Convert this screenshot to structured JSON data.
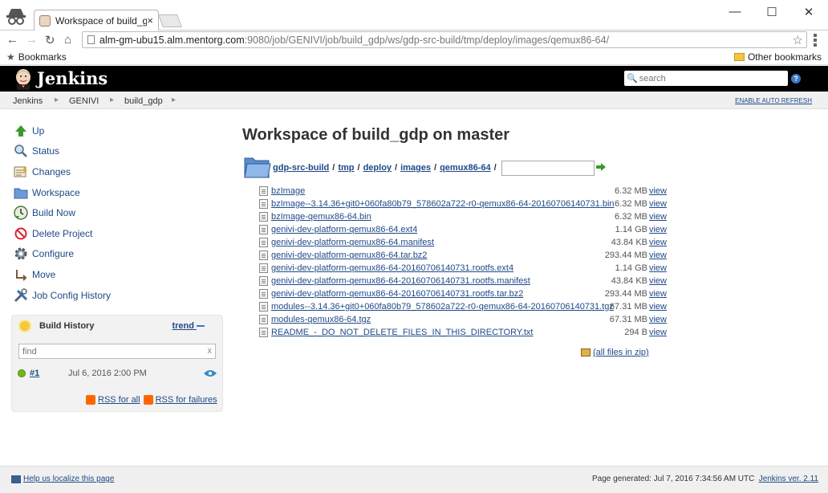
{
  "browser": {
    "tab_title": "Workspace of build_g",
    "tab_close": "×",
    "window_controls": {
      "minimize": "—",
      "maximize": "☐",
      "close": "✕"
    },
    "url_host": "alm-gm-ubu15.alm.mentorg.com",
    "url_path": ":9080/job/GENIVI/job/build_gdp/ws/gdp-src-build/tmp/deploy/images/qemux86-64/",
    "bookmarks_label": "Bookmarks",
    "other_bookmarks_label": "Other bookmarks"
  },
  "header": {
    "logo_text": "Jenkins",
    "search_placeholder": "search",
    "help_label": "?"
  },
  "breadcrumbs": {
    "items": [
      "Jenkins",
      "GENIVI",
      "build_gdp"
    ],
    "separator": "▸",
    "auto_refresh": "ENABLE AUTO REFRESH"
  },
  "sidebar": {
    "tasks": [
      {
        "label": "Up",
        "icon": "up-arrow-icon"
      },
      {
        "label": "Status",
        "icon": "search-icon"
      },
      {
        "label": "Changes",
        "icon": "notepad-icon"
      },
      {
        "label": "Workspace",
        "icon": "folder-icon"
      },
      {
        "label": "Build Now",
        "icon": "clock-icon"
      },
      {
        "label": "Delete Project",
        "icon": "no-entry-icon"
      },
      {
        "label": "Configure",
        "icon": "gear-icon"
      },
      {
        "label": "Move",
        "icon": "move-icon"
      },
      {
        "label": "Job Config History",
        "icon": "tools-icon"
      }
    ]
  },
  "build_history": {
    "title": "Build History",
    "trend_label": "trend",
    "find_placeholder": "find",
    "clear_label": "x",
    "builds": [
      {
        "number": "#1",
        "date": "Jul 6, 2016 2:00 PM",
        "status_color": "#6fb91c"
      }
    ],
    "rss_all": "RSS for all",
    "rss_failures": "RSS for failures"
  },
  "main": {
    "title": "Workspace of build_gdp on master",
    "path": [
      "gdp-src-build",
      "tmp",
      "deploy",
      "images",
      "qemux86-64"
    ],
    "path_separator": "/",
    "files": [
      {
        "name": "bzImage",
        "size": "6.32 MB",
        "view": "view"
      },
      {
        "name": "bzImage--3.14.36+git0+060fa80b79_578602a722-r0-qemux86-64-20160706140731.bin",
        "size": "6.32 MB",
        "view": "view"
      },
      {
        "name": "bzImage-qemux86-64.bin",
        "size": "6.32 MB",
        "view": "view"
      },
      {
        "name": "genivi-dev-platform-qemux86-64.ext4",
        "size": "1.14 GB",
        "view": "view"
      },
      {
        "name": "genivi-dev-platform-qemux86-64.manifest",
        "size": "43.84 KB",
        "view": "view"
      },
      {
        "name": "genivi-dev-platform-qemux86-64.tar.bz2",
        "size": "293.44 MB",
        "view": "view"
      },
      {
        "name": "genivi-dev-platform-qemux86-64-20160706140731.rootfs.ext4",
        "size": "1.14 GB",
        "view": "view"
      },
      {
        "name": "genivi-dev-platform-qemux86-64-20160706140731.rootfs.manifest",
        "size": "43.84 KB",
        "view": "view"
      },
      {
        "name": "genivi-dev-platform-qemux86-64-20160706140731.rootfs.tar.bz2",
        "size": "293.44 MB",
        "view": "view"
      },
      {
        "name": "modules--3.14.36+git0+060fa80b79_578602a722-r0-qemux86-64-20160706140731.tgz",
        "size": "67.31 MB",
        "view": "view"
      },
      {
        "name": "modules-qemux86-64.tgz",
        "size": "67.31 MB",
        "view": "view"
      },
      {
        "name": "README_-_DO_NOT_DELETE_FILES_IN_THIS_DIRECTORY.txt",
        "size": "294 B",
        "view": "view"
      }
    ],
    "all_files_zip": "(all files in zip)"
  },
  "footer": {
    "localize": "Help us localize this page",
    "generated": "Page generated: Jul 7, 2016 7:34:56 AM UTC",
    "version": "Jenkins ver. 2.11"
  }
}
